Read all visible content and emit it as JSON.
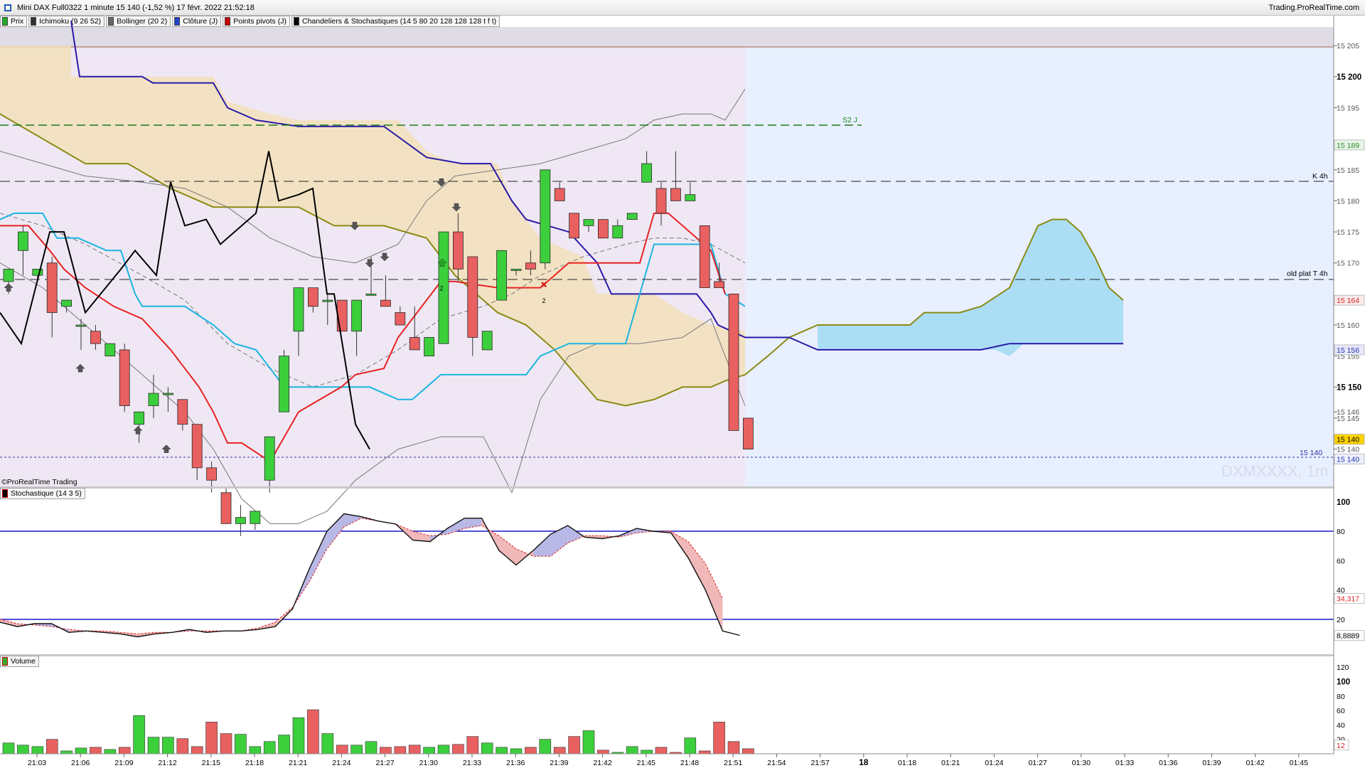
{
  "window": {
    "title": "Mini DAX Full0322 1 minute 15 140 (-1,52 %) 17 févr. 2022 21:52:18",
    "site": "Trading.ProRealTime.com"
  },
  "legend": [
    {
      "label": "Prix",
      "color": "#22aa22"
    },
    {
      "label": "Ichimoku (9 26 52)",
      "color": "#333333"
    },
    {
      "label": "Bollinger (20 2)",
      "color": "#666666"
    },
    {
      "label": "Clôture (J)",
      "color": "#2244cc"
    },
    {
      "label": "Points pivots (J)",
      "color": "#cc0000"
    },
    {
      "label": "Chandeliers & Stochastiques (14 5 80 20 128 128 128 t f t)",
      "color": "#000000"
    }
  ],
  "price_panel": {
    "watermark": "DXMXXXX, 1m",
    "copyright": "©ProRealTime Trading",
    "labels": {
      "s2": "S2 J",
      "k4h": "K 4h",
      "oldplat": "old plat T 4h",
      "lastline": "15 140"
    },
    "markers": {
      "two_a": "2",
      "two_b": "2"
    },
    "ymin": 15134,
    "ymax": 15208,
    "ticks": [
      "15 205",
      "15 200",
      "15 195",
      "15 185",
      "15 180",
      "15 175",
      "15 170",
      "15 160",
      "15 155",
      "15 150",
      "15 146",
      "15 145",
      "15 140"
    ],
    "tick_values": [
      15205,
      15200,
      15195,
      15185,
      15180,
      15175,
      15170,
      15160,
      15155,
      15150,
      15146,
      15145,
      15140
    ],
    "tick_bold": [
      false,
      true,
      false,
      false,
      false,
      false,
      false,
      false,
      false,
      true,
      false,
      false,
      false
    ],
    "badges": [
      {
        "text": "15 189",
        "value": 15189,
        "bg": "#e8f5e8",
        "fg": "#2a8a2a"
      },
      {
        "text": "15 164",
        "value": 15164,
        "bg": "#fbeaea",
        "fg": "#d22"
      },
      {
        "text": "15 156",
        "value": 15156,
        "bg": "#e8e8fb",
        "fg": "#2233aa"
      },
      {
        "text": "15 140",
        "value": 15141.6,
        "bg": "#ffd200",
        "fg": "#000"
      },
      {
        "text": "15 140",
        "value": 15138.4,
        "bg": "#eef0ff",
        "fg": "#2233aa"
      }
    ]
  },
  "stoch_panel": {
    "label": "Stochastique (14 3 5)",
    "ticks": [
      "100",
      "80",
      "60",
      "40",
      "20"
    ],
    "tick_values": [
      100,
      80,
      60,
      40,
      20
    ],
    "tick_bold": [
      true,
      false,
      false,
      false,
      false
    ],
    "badges": [
      {
        "text": "34,317",
        "value": 34.3,
        "fg": "#d22"
      },
      {
        "text": "8,8889",
        "value": 8.9,
        "fg": "#000"
      }
    ],
    "upper": 80,
    "lower": 20
  },
  "volume_panel": {
    "label": "Volume",
    "ticks": [
      "120",
      "100",
      "80",
      "60",
      "40",
      "20"
    ],
    "tick_values": [
      120,
      100,
      80,
      60,
      40,
      20
    ],
    "tick_bold": [
      false,
      true,
      false,
      false,
      false,
      false
    ],
    "badge": {
      "text": "12",
      "value": 12
    }
  },
  "time_axis": {
    "labels": [
      "21:03",
      "21:06",
      "21:09",
      "21:12",
      "21:15",
      "21:18",
      "21:21",
      "21:24",
      "21:27",
      "21:30",
      "21:33",
      "21:36",
      "21:39",
      "21:42",
      "21:45",
      "21:48",
      "21:51",
      "21:54",
      "21:57",
      "18",
      "01:18",
      "01:21",
      "01:24",
      "01:27",
      "01:30",
      "01:33",
      "01:36",
      "01:39",
      "01:42",
      "01:45"
    ],
    "bold_label": "18"
  },
  "chart_data": {
    "type": "candlestick",
    "title": "Mini DAX Full0322 1 minute",
    "candles": [
      {
        "o": 15167,
        "h": 15169,
        "l": 15165,
        "c": 15169
      },
      {
        "o": 15172,
        "h": 15176,
        "l": 15168,
        "c": 15175
      },
      {
        "o": 15168,
        "h": 15169,
        "l": 15167,
        "c": 15169
      },
      {
        "o": 15170,
        "h": 15171,
        "l": 15158,
        "c": 15162
      },
      {
        "o": 15163,
        "h": 15164,
        "l": 15162,
        "c": 15164
      },
      {
        "o": 15160,
        "h": 15161,
        "l": 15156,
        "c": 15160
      },
      {
        "o": 15159,
        "h": 15160,
        "l": 15156,
        "c": 15157
      },
      {
        "o": 15155,
        "h": 15157,
        "l": 15155,
        "c": 15157
      },
      {
        "o": 15156,
        "h": 15157,
        "l": 15146,
        "c": 15147
      },
      {
        "o": 15144,
        "h": 15146,
        "l": 15141,
        "c": 15146
      },
      {
        "o": 15147,
        "h": 15152,
        "l": 15145,
        "c": 15149
      },
      {
        "o": 15149,
        "h": 15150,
        "l": 15146,
        "c": 15149
      },
      {
        "o": 15148,
        "h": 15148,
        "l": 15143,
        "c": 15144
      },
      {
        "o": 15144,
        "h": 15144,
        "l": 15135,
        "c": 15137
      },
      {
        "o": 15137,
        "h": 15138,
        "l": 15133,
        "c": 15135
      },
      {
        "o": 15133,
        "h": 15134,
        "l": 15128,
        "c": 15128
      },
      {
        "o": 15128,
        "h": 15131,
        "l": 15126,
        "c": 15129
      },
      {
        "o": 15128,
        "h": 15130,
        "l": 15127,
        "c": 15130
      },
      {
        "o": 15135,
        "h": 15142,
        "l": 15133,
        "c": 15142
      },
      {
        "o": 15146,
        "h": 15156,
        "l": 15146,
        "c": 15155
      },
      {
        "o": 15159,
        "h": 15166,
        "l": 15155,
        "c": 15166
      },
      {
        "o": 15166,
        "h": 15166,
        "l": 15162,
        "c": 15163
      },
      {
        "o": 15164,
        "h": 15165,
        "l": 15160,
        "c": 15164
      },
      {
        "o": 15164,
        "h": 15164,
        "l": 15159,
        "c": 15159
      },
      {
        "o": 15159,
        "h": 15164,
        "l": 15155,
        "c": 15164
      },
      {
        "o": 15165,
        "h": 15171,
        "l": 15165,
        "c": 15165
      },
      {
        "o": 15164,
        "h": 15168,
        "l": 15163,
        "c": 15163
      },
      {
        "o": 15162,
        "h": 15163,
        "l": 15160,
        "c": 15160
      },
      {
        "o": 15158,
        "h": 15163,
        "l": 15156,
        "c": 15156
      },
      {
        "o": 15155,
        "h": 15158,
        "l": 15155,
        "c": 15158
      },
      {
        "o": 15157,
        "h": 15175,
        "l": 15157,
        "c": 15175
      },
      {
        "o": 15175,
        "h": 15178,
        "l": 15167,
        "c": 15169
      },
      {
        "o": 15171,
        "h": 15171,
        "l": 15155,
        "c": 15158
      },
      {
        "o": 15156,
        "h": 15159,
        "l": 15156,
        "c": 15159
      },
      {
        "o": 15164,
        "h": 15172,
        "l": 15164,
        "c": 15172
      },
      {
        "o": 15169,
        "h": 15169,
        "l": 15168,
        "c": 15169
      },
      {
        "o": 15170,
        "h": 15172,
        "l": 15168,
        "c": 15169
      },
      {
        "o": 15170,
        "h": 15185,
        "l": 15169,
        "c": 15185
      },
      {
        "o": 15182,
        "h": 15183,
        "l": 15181,
        "c": 15180
      },
      {
        "o": 15178,
        "h": 15178,
        "l": 15174,
        "c": 15174
      },
      {
        "o": 15176,
        "h": 15177,
        "l": 15175,
        "c": 15177
      },
      {
        "o": 15177,
        "h": 15177,
        "l": 15174,
        "c": 15174
      },
      {
        "o": 15174,
        "h": 15177,
        "l": 15174,
        "c": 15176
      },
      {
        "o": 15177,
        "h": 15178,
        "l": 15177,
        "c": 15178
      },
      {
        "o": 15183,
        "h": 15188,
        "l": 15183,
        "c": 15186
      },
      {
        "o": 15182,
        "h": 15183,
        "l": 15176,
        "c": 15178
      },
      {
        "o": 15182,
        "h": 15188,
        "l": 15181,
        "c": 15180
      },
      {
        "o": 15180,
        "h": 15183,
        "l": 15180,
        "c": 15181
      },
      {
        "o": 15176,
        "h": 15176,
        "l": 15166,
        "c": 15166
      },
      {
        "o": 15167,
        "h": 15170,
        "l": 15166,
        "c": 15166
      },
      {
        "o": 15165,
        "h": 15165,
        "l": 15143,
        "c": 15143
      },
      {
        "o": 15145,
        "h": 15145,
        "l": 15140,
        "c": 15140
      }
    ],
    "stochastic_k": [
      18,
      15,
      17,
      17,
      11,
      12,
      11,
      10,
      8,
      10,
      11,
      13,
      11,
      12,
      12,
      13,
      15,
      27,
      55,
      80,
      92,
      90,
      87,
      85,
      74,
      73,
      82,
      89,
      89,
      67,
      57,
      67,
      78,
      84,
      76,
      75,
      77,
      82,
      80,
      79,
      62,
      40,
      12,
      9
    ],
    "stochastic_d": [
      20,
      17,
      16,
      15,
      13,
      12,
      12,
      11,
      10,
      11,
      11,
      12,
      12,
      12,
      12,
      14,
      18,
      28,
      46,
      68,
      83,
      89,
      87,
      85,
      80,
      77,
      78,
      82,
      84,
      77,
      68,
      63,
      63,
      72,
      77,
      77,
      76,
      79,
      80,
      80,
      73,
      58,
      34
    ],
    "volume": [
      15,
      12,
      10,
      20,
      4,
      8,
      9,
      6,
      9,
      53,
      23,
      23,
      21,
      10,
      44,
      28,
      27,
      10,
      17,
      26,
      50,
      61,
      28,
      12,
      12,
      17,
      9,
      10,
      12,
      9,
      12,
      13,
      24,
      15,
      9,
      7,
      9,
      20,
      9,
      24,
      32,
      5,
      2,
      10,
      5,
      9,
      2,
      22,
      4,
      44,
      17,
      7
    ],
    "stoch_levels": [
      80,
      20
    ],
    "volume_axis_max": 120
  }
}
